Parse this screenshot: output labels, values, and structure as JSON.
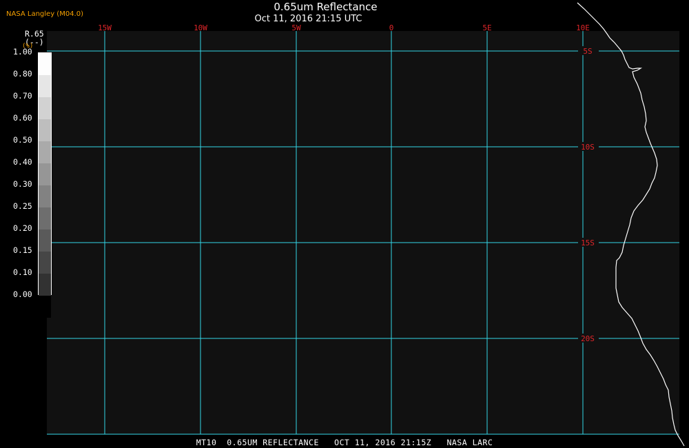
{
  "header": {
    "title": "0.65um Reflectance",
    "datetime": "Oct 11, 2016 21:15 UTC",
    "credit": "NASA Langley (M04.0)"
  },
  "legend": {
    "variable": "R.65",
    "units": "(--)",
    "units_note": "(%)",
    "ticks": [
      "1.00",
      "0.80",
      "0.70",
      "0.60",
      "0.50",
      "0.40",
      "0.30",
      "0.25",
      "0.20",
      "0.15",
      "0.10",
      "0.00"
    ],
    "swatch_colors": [
      "#fdfdfd",
      "#e6e6e6",
      "#d2d2d2",
      "#bebebe",
      "#aaaaaa",
      "#969696",
      "#828282",
      "#6e6e6e",
      "#5a5a5a",
      "#464646",
      "#323232",
      "#000000"
    ]
  },
  "map": {
    "longitude_labels": [
      "15W",
      "10W",
      "5W",
      "0",
      "5E",
      "10E"
    ],
    "latitude_labels": [
      "5S",
      "10S",
      "15S",
      "20S"
    ],
    "grid_color": "#33d6e8",
    "label_color": "#e0262a",
    "coastline_color": "#ffffff",
    "background_color": "#111111"
  },
  "footer": {
    "caption": "MT10  0.65UM REFLECTANCE   OCT 11, 2016 21:15Z   NASA LARC"
  }
}
